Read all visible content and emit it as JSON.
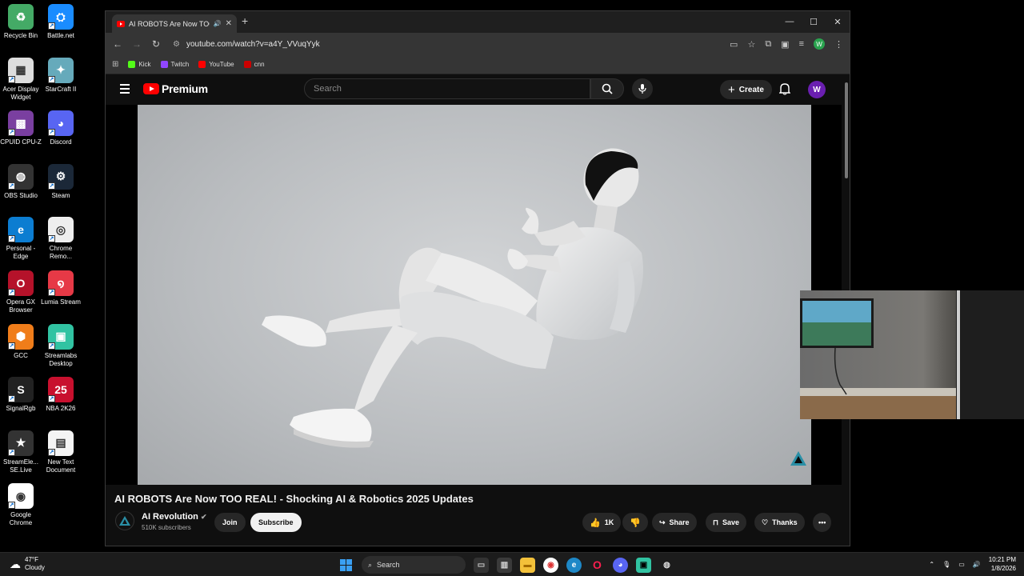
{
  "desktop": {
    "icons": [
      {
        "label": "Recycle Bin",
        "icon": "recycle-bin-icon"
      },
      {
        "label": "Battle.net",
        "icon": "battlenet-icon"
      },
      {
        "label": "Acer Display Widget",
        "icon": "acer-display-icon"
      },
      {
        "label": "StarCraft II",
        "icon": "starcraft-icon"
      },
      {
        "label": "CPUID CPU-Z",
        "icon": "cpuz-icon"
      },
      {
        "label": "Discord",
        "icon": "discord-icon"
      },
      {
        "label": "OBS Studio",
        "icon": "obs-icon"
      },
      {
        "label": "Steam",
        "icon": "steam-icon"
      },
      {
        "label": "Personal - Edge",
        "icon": "edge-icon"
      },
      {
        "label": "Chrome Remo...",
        "icon": "chrome-remote-icon"
      },
      {
        "label": "Opera GX Browser",
        "icon": "opera-gx-icon"
      },
      {
        "label": "Lumia Stream",
        "icon": "lumia-stream-icon"
      },
      {
        "label": "GCC",
        "icon": "gcc-icon"
      },
      {
        "label": "Streamlabs Desktop",
        "icon": "streamlabs-icon"
      },
      {
        "label": "SignalRgb",
        "icon": "signalrgb-icon"
      },
      {
        "label": "NBA 2K26",
        "icon": "nba2k-icon"
      },
      {
        "label": "StreamEle... SE.Live",
        "icon": "streamelements-icon"
      },
      {
        "label": "New Text Document",
        "icon": "text-document-icon"
      },
      {
        "label": "Google Chrome",
        "icon": "chrome-icon"
      }
    ]
  },
  "browser": {
    "tab_title": "AI ROBOTS Are Now TOO R",
    "new_tab": "+",
    "url": "youtube.com/watch?v=a4Y_VVuqYyk",
    "profile_initial": "W",
    "bookmarks": [
      {
        "label": "Kick",
        "color": "#53fc18"
      },
      {
        "label": "Twitch",
        "color": "#9146ff"
      },
      {
        "label": "YouTube",
        "color": "#ff0000"
      },
      {
        "label": "cnn",
        "color": "#cc0000"
      }
    ]
  },
  "youtube": {
    "logo_text": "Premium",
    "search_placeholder": "Search",
    "create_label": "Create",
    "avatar_initial": "W",
    "video_title": "AI ROBOTS Are Now TOO REAL! - Shocking AI & Robotics 2025 Updates",
    "channel_name": "AI Revolution",
    "subscribers": "510K subscribers",
    "join_label": "Join",
    "subscribe_label": "Subscribe",
    "like_count": "1K",
    "share_label": "Share",
    "save_label": "Save",
    "thanks_label": "Thanks"
  },
  "taskbar": {
    "temperature": "47°F",
    "weather": "Cloudy",
    "search_label": "Search",
    "time": "10:21 PM",
    "date": "1/8/2026"
  }
}
